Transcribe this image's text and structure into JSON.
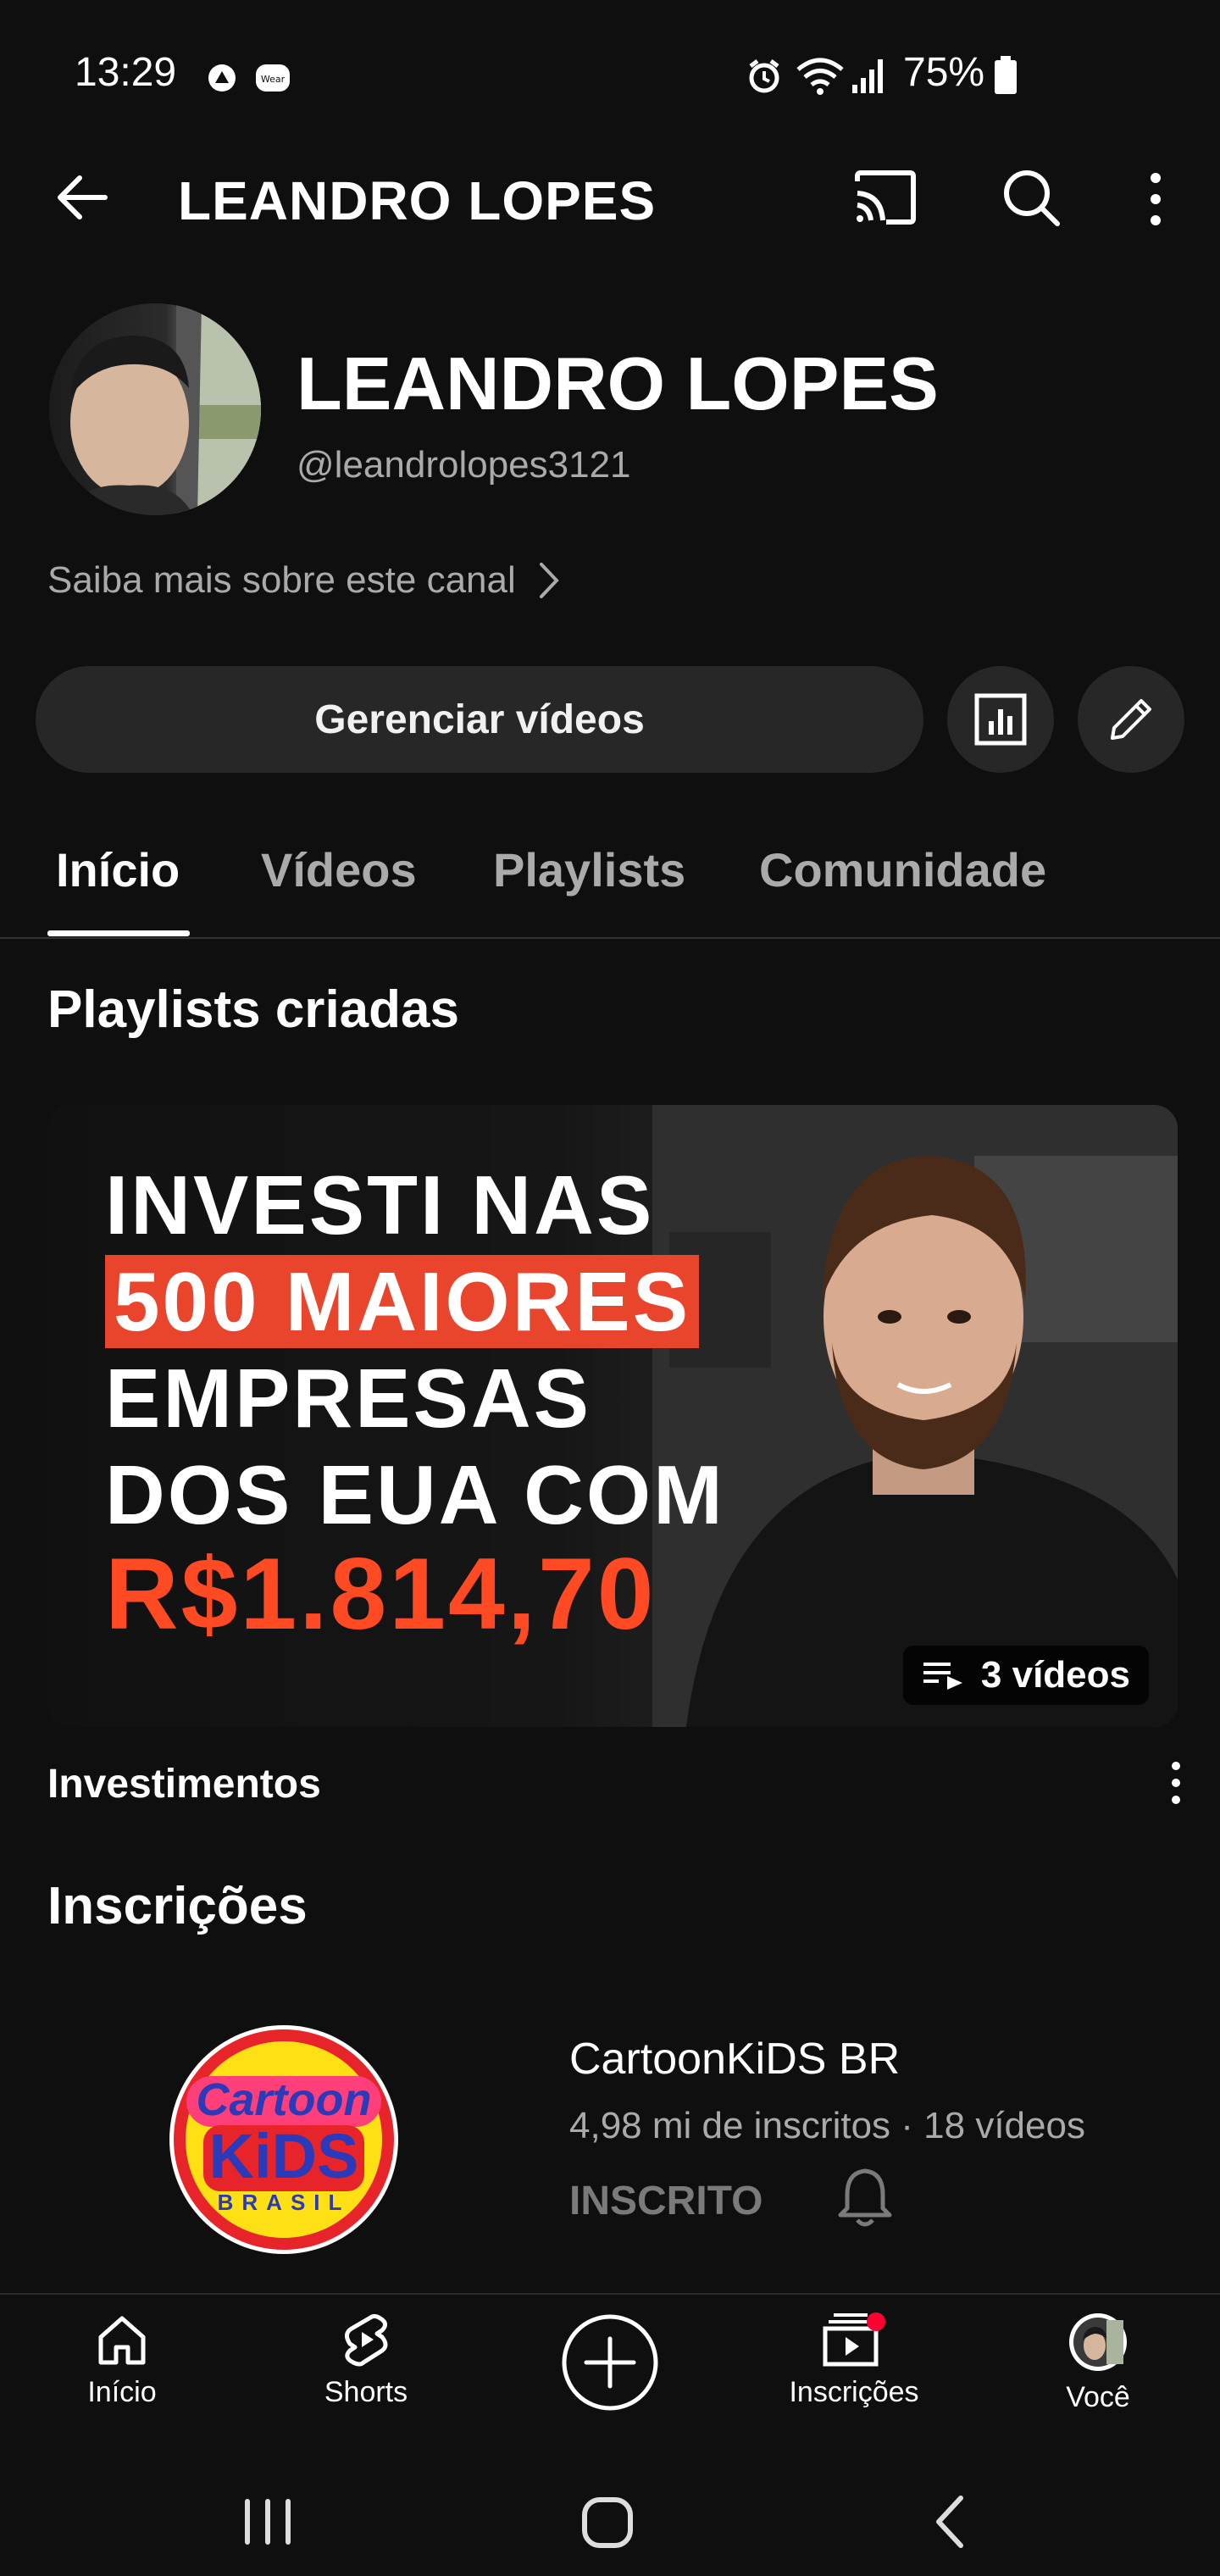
{
  "status_bar": {
    "time": "13:29",
    "battery": "75%"
  },
  "header": {
    "title": "LEANDRO LOPES"
  },
  "channel": {
    "name": "LEANDRO LOPES",
    "handle": "@leandrolopes3121",
    "about_link": "Saiba mais sobre este canal",
    "manage_button": "Gerenciar vídeos"
  },
  "tabs": [
    {
      "label": "Início",
      "active": true
    },
    {
      "label": "Vídeos",
      "active": false
    },
    {
      "label": "Playlists",
      "active": false
    },
    {
      "label": "Comunidade",
      "active": false
    }
  ],
  "playlists_section": {
    "title": "Playlists criadas",
    "items": [
      {
        "thumbnail_lines": [
          "INVESTI NAS",
          "500 MAIORES",
          "EMPRESAS",
          "DOS EUA COM",
          "R$1.814,70"
        ],
        "video_count": "3 vídeos",
        "title": "Investimentos"
      }
    ]
  },
  "subscriptions_section": {
    "title": "Inscrições",
    "items": [
      {
        "logo_text": [
          "Cartoon",
          "KiDS",
          "BRASIL"
        ],
        "name": "CartoonKiDS BR",
        "meta": "4,98 mi de inscritos · 18 vídeos",
        "status": "INSCRITO"
      }
    ]
  },
  "bottom_nav": [
    {
      "label": "Início",
      "icon": "home-icon"
    },
    {
      "label": "Shorts",
      "icon": "shorts-icon"
    },
    {
      "label": "",
      "icon": "create-icon"
    },
    {
      "label": "Inscrições",
      "icon": "subscriptions-icon"
    },
    {
      "label": "Você",
      "icon": "you-avatar"
    }
  ],
  "colors": {
    "background": "#0f0f0f",
    "surface": "#272727",
    "secondary_text": "#aaaaaa",
    "accent_red": "#ff4a23",
    "notification_dot": "#ff0033"
  }
}
